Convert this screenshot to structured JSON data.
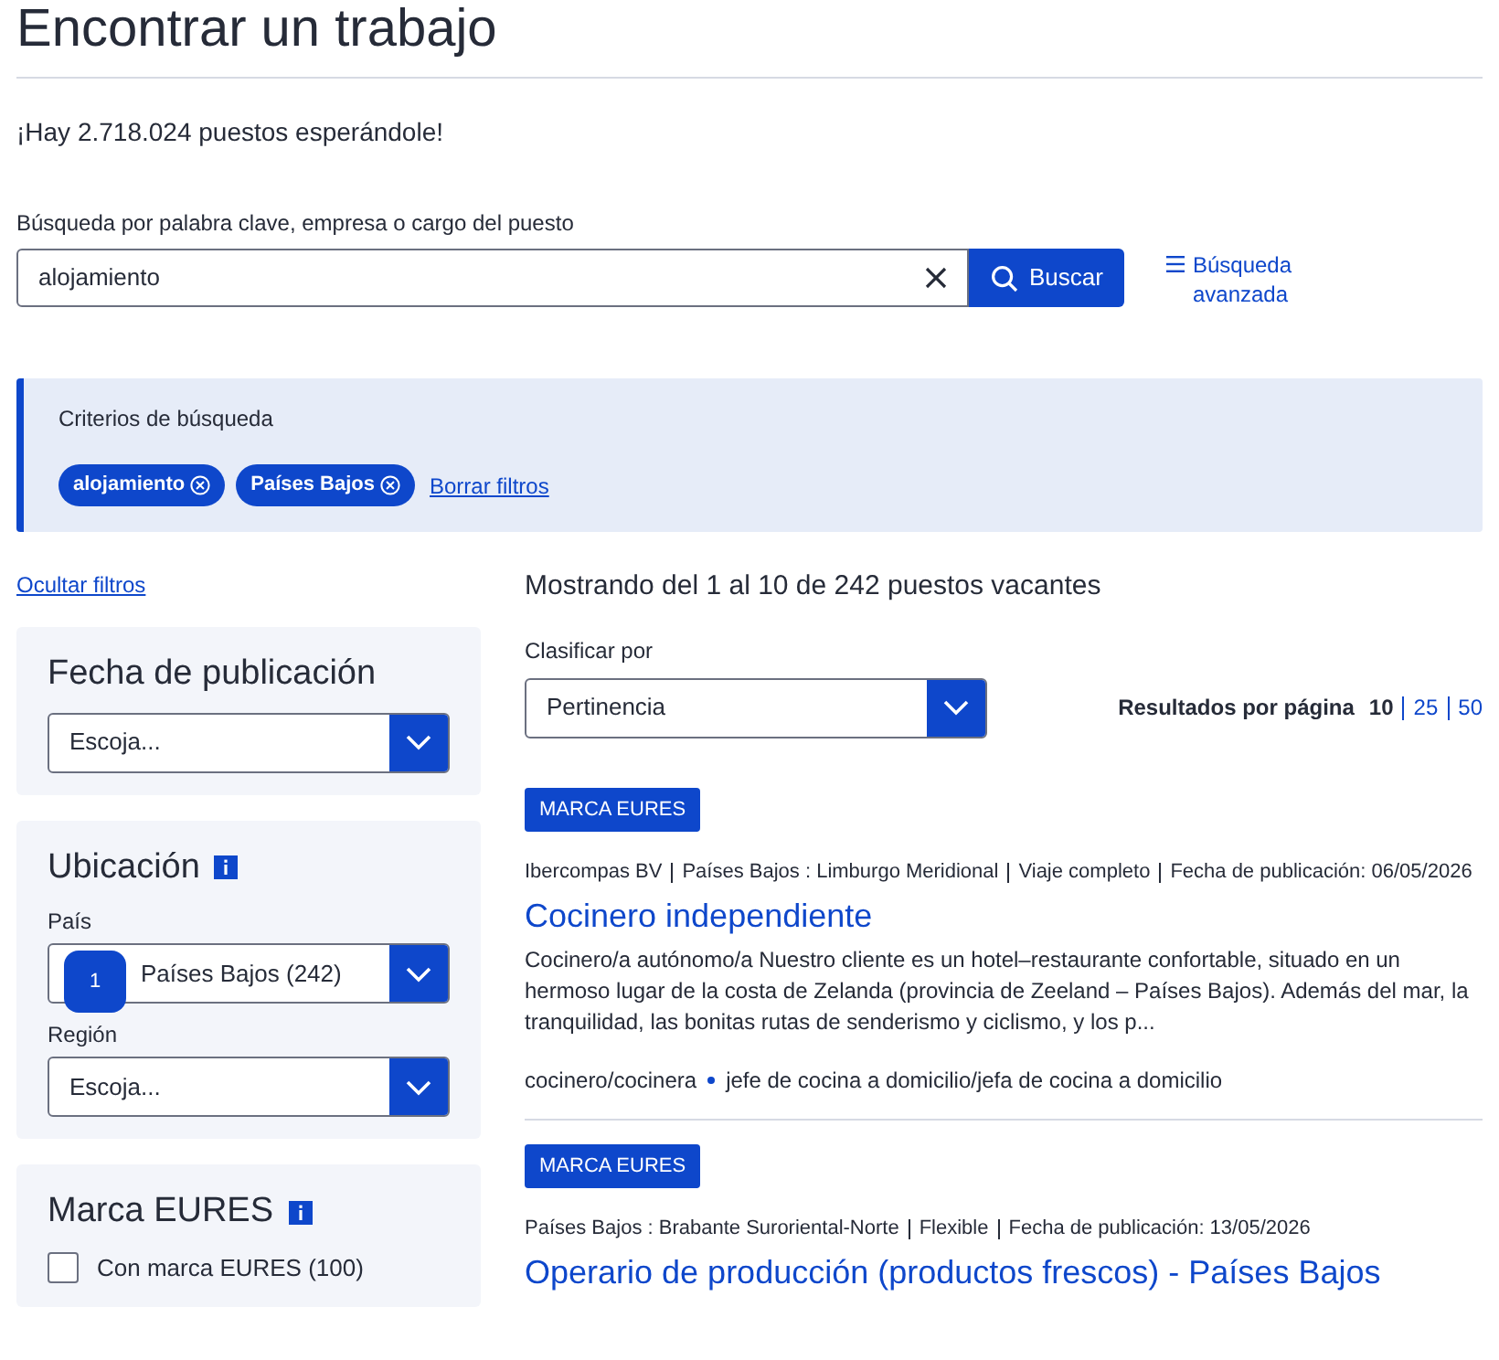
{
  "page_title": "Encontrar un trabajo",
  "job_count_text": "¡Hay 2.718.024 puestos esperándole!",
  "search": {
    "label": "Búsqueda por palabra clave, empresa o cargo del puesto",
    "value": "alojamiento",
    "button": "Buscar",
    "advanced_link": "Búsqueda avanzada"
  },
  "criteria": {
    "title": "Criterios de búsqueda",
    "chips": [
      "alojamiento",
      "Países Bajos"
    ],
    "clear_link": "Borrar filtros"
  },
  "hide_filters_link": "Ocultar filtros",
  "filters": [
    {
      "kind": "select",
      "title": "Fecha de publicación",
      "info": false,
      "fields": [
        {
          "value": "Escoja..."
        }
      ]
    },
    {
      "kind": "select",
      "title": "Ubicación",
      "info": true,
      "fields": [
        {
          "label": "País",
          "value": "Países Bajos (242)",
          "badge": "1"
        },
        {
          "label": "Región",
          "value": "Escoja..."
        }
      ]
    },
    {
      "kind": "checkbox",
      "title": "Marca EURES",
      "info": true,
      "options": [
        {
          "label": "Con marca EURES (100)",
          "checked": false
        }
      ]
    }
  ],
  "results": {
    "summary": "Mostrando del 1 al 10 de 242 puestos vacantes",
    "sort_label": "Clasificar por",
    "sort_value": "Pertinencia",
    "per_page_label": "Resultados por página",
    "per_page_options": [
      {
        "label": "10",
        "selected": true
      },
      {
        "label": "25",
        "selected": false
      },
      {
        "label": "50",
        "selected": false
      }
    ]
  },
  "jobs": [
    {
      "badge": "MARCA EURES",
      "meta": [
        "Ibercompas BV",
        "Países Bajos : Limburgo Meridional",
        "Viaje completo",
        "Fecha de publicación: 06/05/2026"
      ],
      "title": "Cocinero independiente",
      "description": "Cocinero/a autónomo/a Nuestro cliente es un hotel–restaurante confortable, situado en un hermoso lugar de la costa de Zelanda (provincia de Zeeland – Países Bajos). Además del mar, la tranquilidad, las bonitas rutas de senderismo y ciclismo, y los p...",
      "tags": [
        "cocinero/cocinera",
        "jefe de cocina a domicilio/jefa de cocina a domicilio"
      ]
    },
    {
      "badge": "MARCA EURES",
      "meta": [
        "Países Bajos : Brabante Suroriental-Norte",
        "Flexible",
        "Fecha de publicación: 13/05/2026"
      ],
      "title": "Operario de producción (productos frescos) - Países Bajos"
    }
  ]
}
